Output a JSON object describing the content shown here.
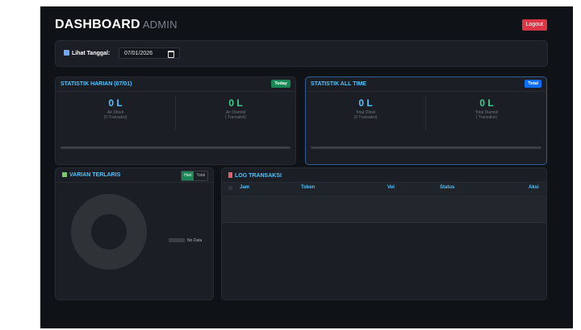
{
  "header": {
    "title": "DASHBOARD",
    "subtitle": "ADMIN",
    "logout_label": "Logout"
  },
  "datebar": {
    "label": "Lihat Tanggal:",
    "date_value": "07/01/2026",
    "icon": "calendar-icon"
  },
  "stat_harian": {
    "title": "STATISTIK HARIAN (07/01)",
    "badge": "Today",
    "left": {
      "value": "0 L",
      "caption1": "Air Dibeli",
      "caption2": "(0 Transaksi)"
    },
    "right": {
      "value": "0 L",
      "caption1": "Air Diambil",
      "caption2": "( Transaksi)"
    }
  },
  "stat_all": {
    "title": "STATISTIK ALL TIME",
    "badge": "Total",
    "left": {
      "value": "0 L",
      "caption1": "Total Dibeli",
      "caption2": "(0 Transaksi)"
    },
    "right": {
      "value": "0 L",
      "caption1": "Total Diambil",
      "caption2": "( Transaksi)"
    }
  },
  "varian": {
    "title": "VARIAN TERLARIS",
    "toggle": {
      "hari": "Hari",
      "total": "Total"
    },
    "legend_no_data": "No Data"
  },
  "log": {
    "title": "LOG TRANSAKSI",
    "columns": {
      "jam": "Jam",
      "token": "Token",
      "vol": "Vol",
      "status": "Status",
      "aksi": "Aksi"
    }
  },
  "colors": {
    "accent": "#4dc4ff",
    "success": "#198754",
    "danger": "#dc3545",
    "primary": "#0d6efd"
  }
}
